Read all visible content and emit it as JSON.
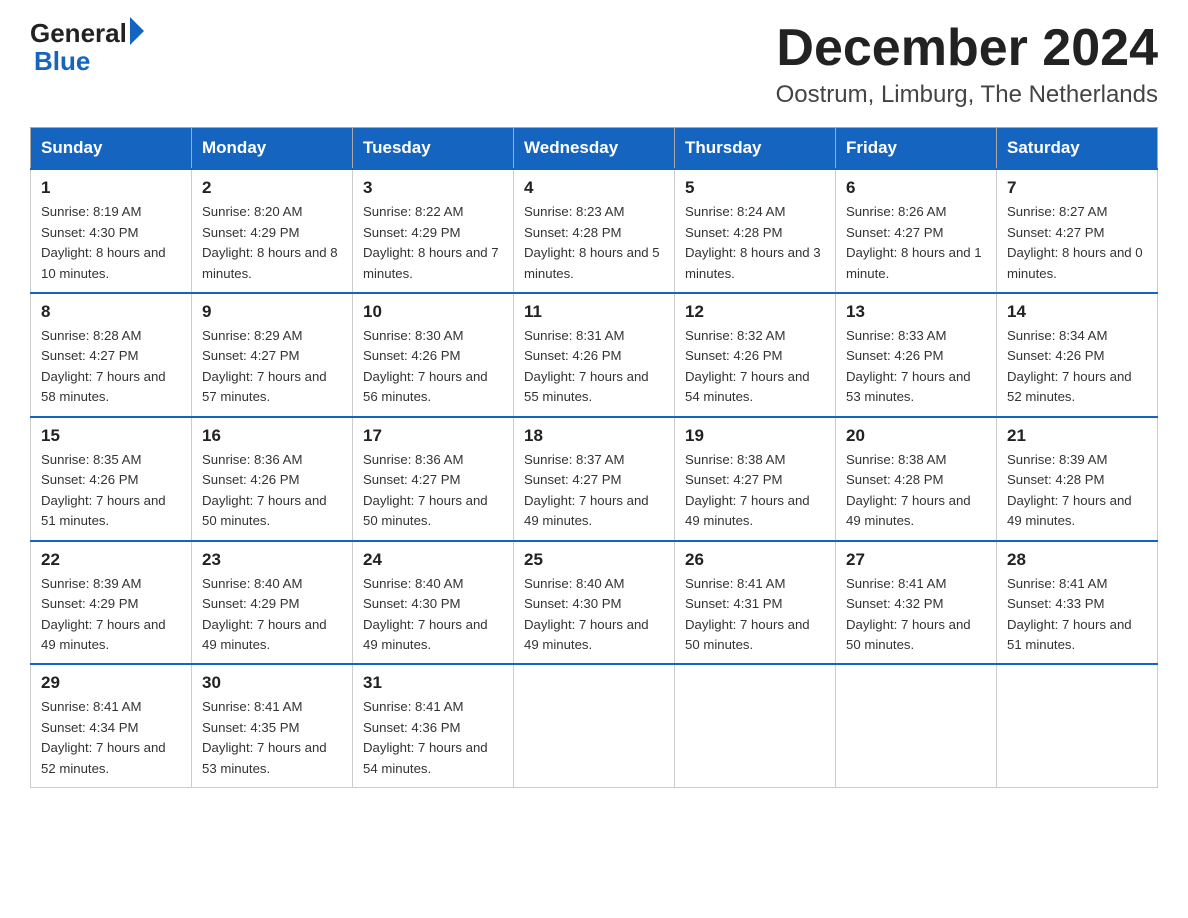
{
  "header": {
    "logo_general": "General",
    "logo_blue": "Blue",
    "title": "December 2024",
    "subtitle": "Oostrum, Limburg, The Netherlands"
  },
  "weekdays": [
    "Sunday",
    "Monday",
    "Tuesday",
    "Wednesday",
    "Thursday",
    "Friday",
    "Saturday"
  ],
  "weeks": [
    [
      {
        "day": "1",
        "sunrise": "Sunrise: 8:19 AM",
        "sunset": "Sunset: 4:30 PM",
        "daylight": "Daylight: 8 hours and 10 minutes."
      },
      {
        "day": "2",
        "sunrise": "Sunrise: 8:20 AM",
        "sunset": "Sunset: 4:29 PM",
        "daylight": "Daylight: 8 hours and 8 minutes."
      },
      {
        "day": "3",
        "sunrise": "Sunrise: 8:22 AM",
        "sunset": "Sunset: 4:29 PM",
        "daylight": "Daylight: 8 hours and 7 minutes."
      },
      {
        "day": "4",
        "sunrise": "Sunrise: 8:23 AM",
        "sunset": "Sunset: 4:28 PM",
        "daylight": "Daylight: 8 hours and 5 minutes."
      },
      {
        "day": "5",
        "sunrise": "Sunrise: 8:24 AM",
        "sunset": "Sunset: 4:28 PM",
        "daylight": "Daylight: 8 hours and 3 minutes."
      },
      {
        "day": "6",
        "sunrise": "Sunrise: 8:26 AM",
        "sunset": "Sunset: 4:27 PM",
        "daylight": "Daylight: 8 hours and 1 minute."
      },
      {
        "day": "7",
        "sunrise": "Sunrise: 8:27 AM",
        "sunset": "Sunset: 4:27 PM",
        "daylight": "Daylight: 8 hours and 0 minutes."
      }
    ],
    [
      {
        "day": "8",
        "sunrise": "Sunrise: 8:28 AM",
        "sunset": "Sunset: 4:27 PM",
        "daylight": "Daylight: 7 hours and 58 minutes."
      },
      {
        "day": "9",
        "sunrise": "Sunrise: 8:29 AM",
        "sunset": "Sunset: 4:27 PM",
        "daylight": "Daylight: 7 hours and 57 minutes."
      },
      {
        "day": "10",
        "sunrise": "Sunrise: 8:30 AM",
        "sunset": "Sunset: 4:26 PM",
        "daylight": "Daylight: 7 hours and 56 minutes."
      },
      {
        "day": "11",
        "sunrise": "Sunrise: 8:31 AM",
        "sunset": "Sunset: 4:26 PM",
        "daylight": "Daylight: 7 hours and 55 minutes."
      },
      {
        "day": "12",
        "sunrise": "Sunrise: 8:32 AM",
        "sunset": "Sunset: 4:26 PM",
        "daylight": "Daylight: 7 hours and 54 minutes."
      },
      {
        "day": "13",
        "sunrise": "Sunrise: 8:33 AM",
        "sunset": "Sunset: 4:26 PM",
        "daylight": "Daylight: 7 hours and 53 minutes."
      },
      {
        "day": "14",
        "sunrise": "Sunrise: 8:34 AM",
        "sunset": "Sunset: 4:26 PM",
        "daylight": "Daylight: 7 hours and 52 minutes."
      }
    ],
    [
      {
        "day": "15",
        "sunrise": "Sunrise: 8:35 AM",
        "sunset": "Sunset: 4:26 PM",
        "daylight": "Daylight: 7 hours and 51 minutes."
      },
      {
        "day": "16",
        "sunrise": "Sunrise: 8:36 AM",
        "sunset": "Sunset: 4:26 PM",
        "daylight": "Daylight: 7 hours and 50 minutes."
      },
      {
        "day": "17",
        "sunrise": "Sunrise: 8:36 AM",
        "sunset": "Sunset: 4:27 PM",
        "daylight": "Daylight: 7 hours and 50 minutes."
      },
      {
        "day": "18",
        "sunrise": "Sunrise: 8:37 AM",
        "sunset": "Sunset: 4:27 PM",
        "daylight": "Daylight: 7 hours and 49 minutes."
      },
      {
        "day": "19",
        "sunrise": "Sunrise: 8:38 AM",
        "sunset": "Sunset: 4:27 PM",
        "daylight": "Daylight: 7 hours and 49 minutes."
      },
      {
        "day": "20",
        "sunrise": "Sunrise: 8:38 AM",
        "sunset": "Sunset: 4:28 PM",
        "daylight": "Daylight: 7 hours and 49 minutes."
      },
      {
        "day": "21",
        "sunrise": "Sunrise: 8:39 AM",
        "sunset": "Sunset: 4:28 PM",
        "daylight": "Daylight: 7 hours and 49 minutes."
      }
    ],
    [
      {
        "day": "22",
        "sunrise": "Sunrise: 8:39 AM",
        "sunset": "Sunset: 4:29 PM",
        "daylight": "Daylight: 7 hours and 49 minutes."
      },
      {
        "day": "23",
        "sunrise": "Sunrise: 8:40 AM",
        "sunset": "Sunset: 4:29 PM",
        "daylight": "Daylight: 7 hours and 49 minutes."
      },
      {
        "day": "24",
        "sunrise": "Sunrise: 8:40 AM",
        "sunset": "Sunset: 4:30 PM",
        "daylight": "Daylight: 7 hours and 49 minutes."
      },
      {
        "day": "25",
        "sunrise": "Sunrise: 8:40 AM",
        "sunset": "Sunset: 4:30 PM",
        "daylight": "Daylight: 7 hours and 49 minutes."
      },
      {
        "day": "26",
        "sunrise": "Sunrise: 8:41 AM",
        "sunset": "Sunset: 4:31 PM",
        "daylight": "Daylight: 7 hours and 50 minutes."
      },
      {
        "day": "27",
        "sunrise": "Sunrise: 8:41 AM",
        "sunset": "Sunset: 4:32 PM",
        "daylight": "Daylight: 7 hours and 50 minutes."
      },
      {
        "day": "28",
        "sunrise": "Sunrise: 8:41 AM",
        "sunset": "Sunset: 4:33 PM",
        "daylight": "Daylight: 7 hours and 51 minutes."
      }
    ],
    [
      {
        "day": "29",
        "sunrise": "Sunrise: 8:41 AM",
        "sunset": "Sunset: 4:34 PM",
        "daylight": "Daylight: 7 hours and 52 minutes."
      },
      {
        "day": "30",
        "sunrise": "Sunrise: 8:41 AM",
        "sunset": "Sunset: 4:35 PM",
        "daylight": "Daylight: 7 hours and 53 minutes."
      },
      {
        "day": "31",
        "sunrise": "Sunrise: 8:41 AM",
        "sunset": "Sunset: 4:36 PM",
        "daylight": "Daylight: 7 hours and 54 minutes."
      },
      null,
      null,
      null,
      null
    ]
  ]
}
